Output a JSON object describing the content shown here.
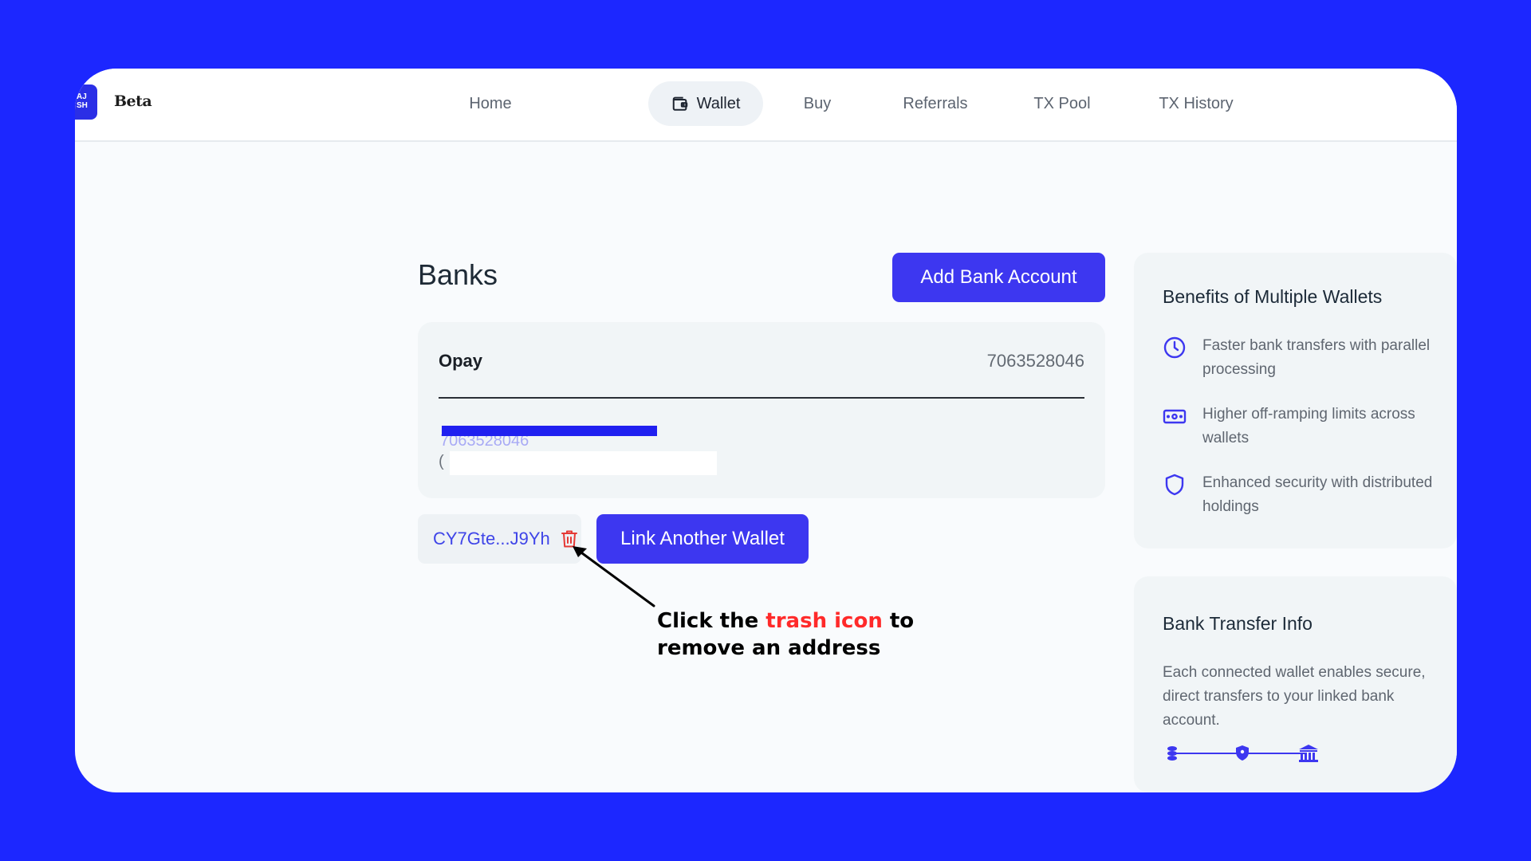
{
  "brand": {
    "logo_text": "AJ SH",
    "badge": "Beta"
  },
  "nav": {
    "items": [
      {
        "label": "Home"
      },
      {
        "label": "Wallet"
      },
      {
        "label": "Buy"
      },
      {
        "label": "Referrals"
      },
      {
        "label": "TX Pool"
      },
      {
        "label": "TX History"
      }
    ],
    "active": "Wallet"
  },
  "banks": {
    "title": "Banks",
    "add_button": "Add Bank Account",
    "card": {
      "bank_name": "Opay",
      "account_number": "7063528046",
      "redacted_line_1": "7063528046",
      "redacted_line_2": "("
    }
  },
  "wallets": {
    "address": "CY7Gte...J9Yh",
    "link_button": "Link Another Wallet"
  },
  "annotation": {
    "part1": "Click the ",
    "highlight": "trash icon",
    "part2": " to",
    "line2": "remove an address"
  },
  "benefits": {
    "title": "Benefits of Multiple Wallets",
    "items": [
      {
        "icon": "clock-icon",
        "text": "Faster bank transfers with parallel processing"
      },
      {
        "icon": "cash-icon",
        "text": "Higher off-ramping limits across wallets"
      },
      {
        "icon": "shield-icon",
        "text": "Enhanced security with distributed holdings"
      }
    ]
  },
  "transfer_info": {
    "title": "Bank Transfer Info",
    "description": "Each connected wallet enables secure, direct transfers to your linked bank account.",
    "flow_icons": [
      "coins-icon",
      "shield-icon",
      "bank-icon"
    ]
  },
  "colors": {
    "background": "#1c27ff",
    "accent": "#3d37f0",
    "danger": "#e53935",
    "callout_highlight": "#ff2a2a"
  }
}
